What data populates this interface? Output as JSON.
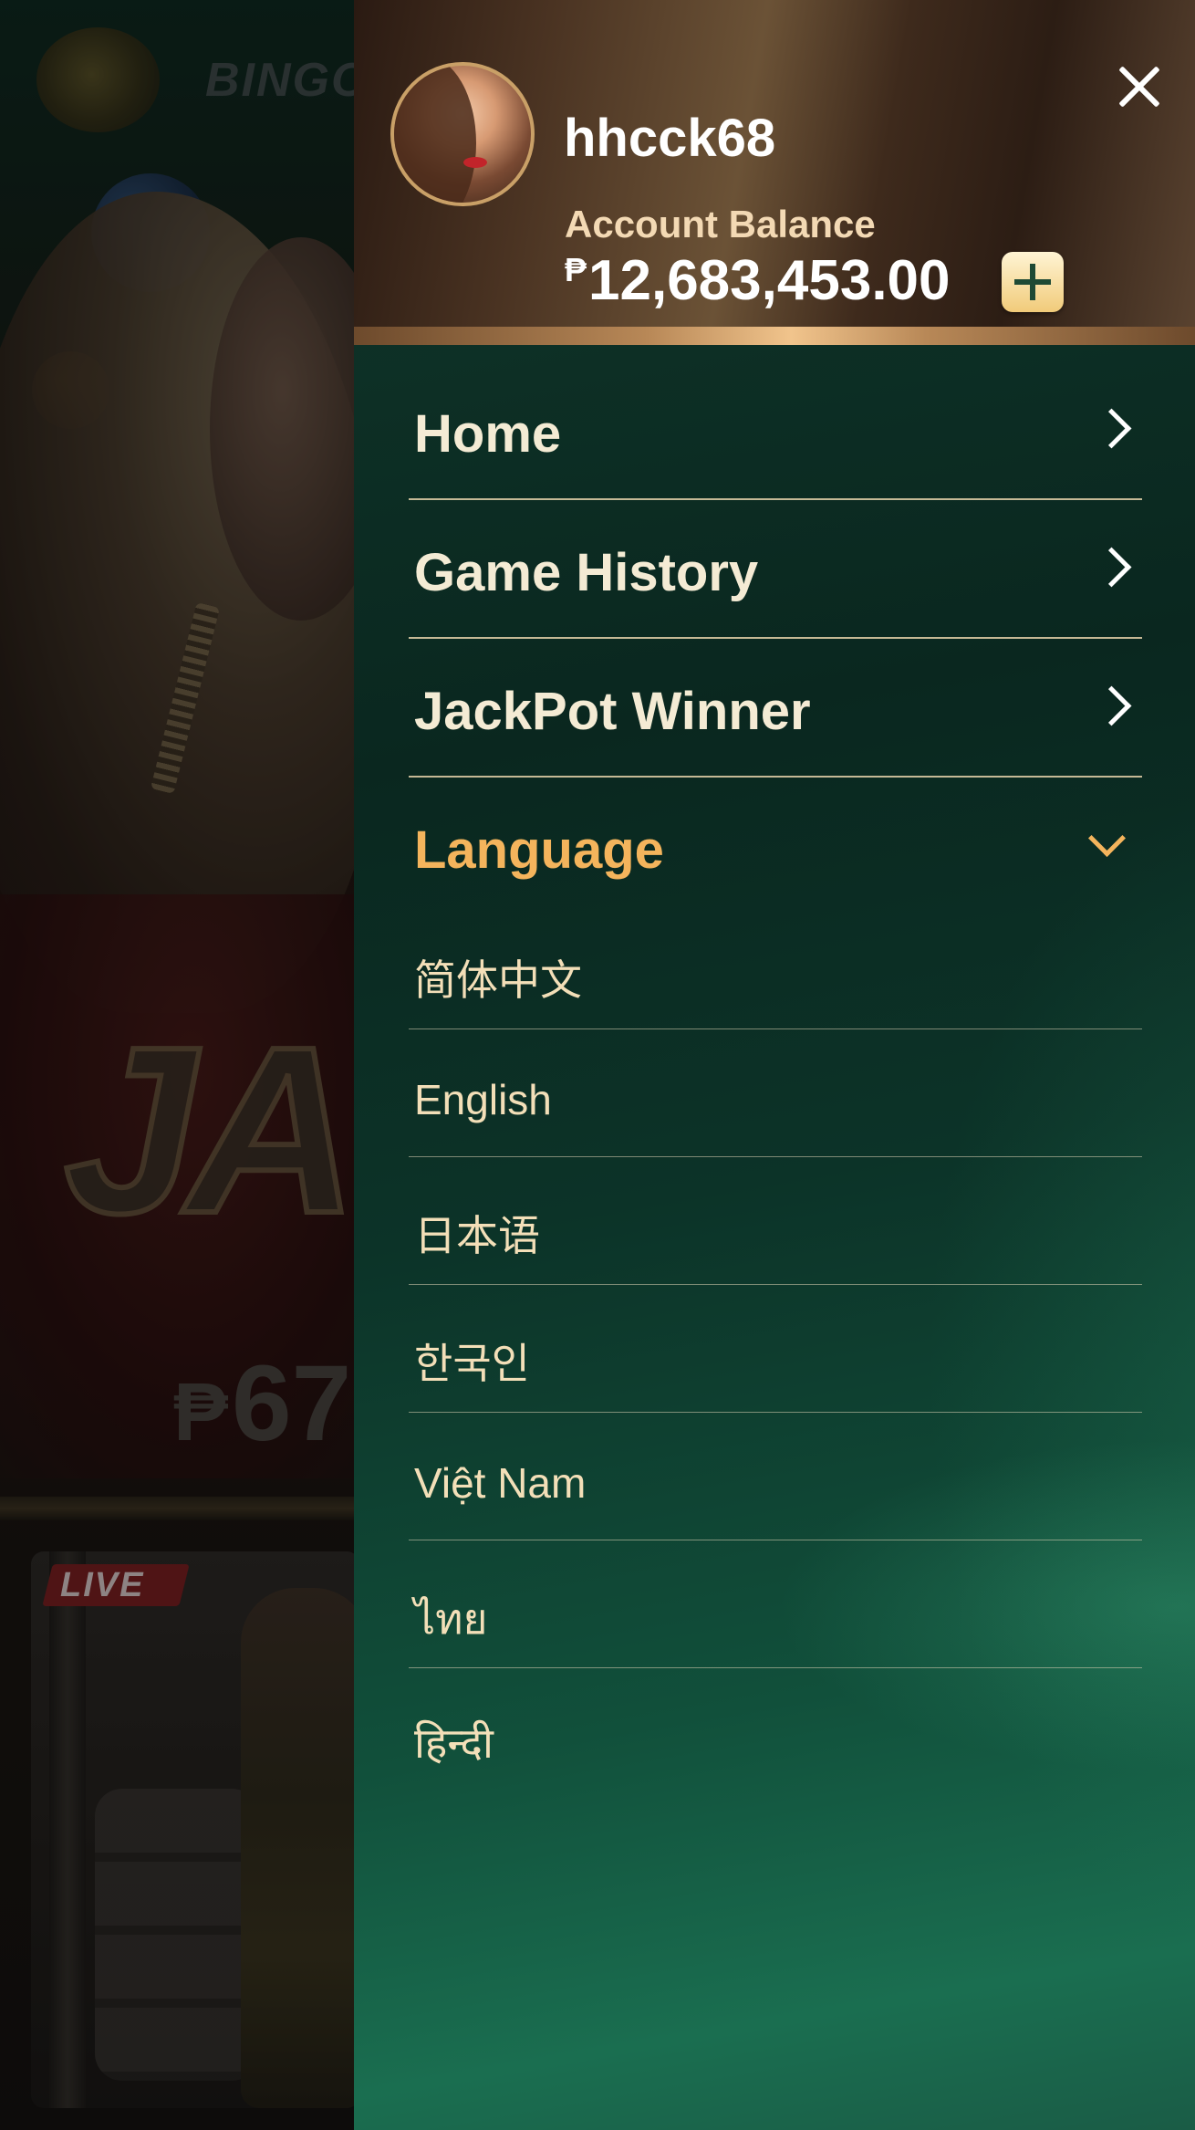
{
  "background": {
    "logo_text": "BINGO",
    "jackpot_text": "JA",
    "amount_text": "67",
    "currency_symbol": "₱",
    "live_badge": "LIVE"
  },
  "drawer": {
    "username": "hhcck68",
    "balance_label": "Account Balance",
    "currency_symbol": "₱",
    "balance_value": "12,683,453.00",
    "icons": [
      "plus-icon",
      "close-icon",
      "chevron-right-icon",
      "chevron-down-icon"
    ],
    "menu": {
      "items": [
        {
          "label": "Home"
        },
        {
          "label": "Game History"
        },
        {
          "label": "JackPot Winner"
        }
      ],
      "language_label": "Language"
    },
    "languages": [
      {
        "label": "简体中文"
      },
      {
        "label": "English"
      },
      {
        "label": "日本语"
      },
      {
        "label": "한국인"
      },
      {
        "label": "Việt Nam"
      },
      {
        "label": "ไทย"
      },
      {
        "label": "हिन्दी"
      }
    ]
  },
  "colors": {
    "accent_gold": "#f4b45c",
    "drawer_green": "#0d2f25",
    "text_cream": "#f4ebd4"
  }
}
